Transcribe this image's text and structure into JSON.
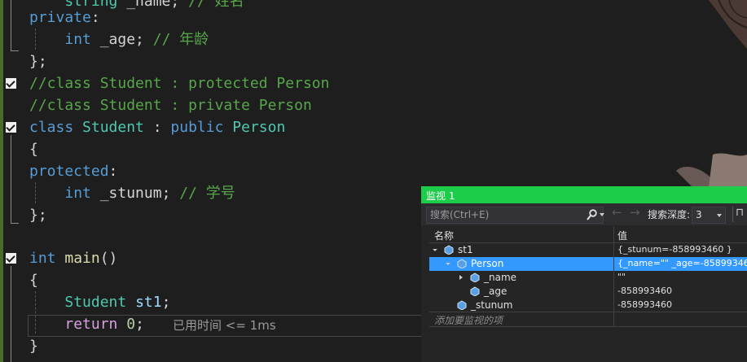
{
  "editor": {
    "lines": [
      {
        "id": "l0",
        "segments": [
          {
            "cls": "ty",
            "text": "    string"
          },
          {
            "cls": "",
            "text": " _name; "
          },
          {
            "cls": "cm",
            "text": "// 姓名"
          }
        ]
      },
      {
        "id": "l1",
        "segments": [
          {
            "cls": "kw",
            "text": "private"
          },
          {
            "cls": "",
            "text": ":"
          }
        ]
      },
      {
        "id": "l2",
        "segments": [
          {
            "cls": "",
            "text": "    "
          },
          {
            "cls": "kw",
            "text": "int"
          },
          {
            "cls": "",
            "text": " _age; "
          },
          {
            "cls": "cm",
            "text": "// 年龄"
          }
        ]
      },
      {
        "id": "l3",
        "segments": [
          {
            "cls": "",
            "text": "};"
          }
        ]
      },
      {
        "id": "l4",
        "segments": [
          {
            "cls": "cm",
            "text": "//class Student : protected Person"
          }
        ]
      },
      {
        "id": "l5",
        "segments": [
          {
            "cls": "cm",
            "text": "//class Student : private Person"
          }
        ]
      },
      {
        "id": "l6",
        "segments": [
          {
            "cls": "kw",
            "text": "class"
          },
          {
            "cls": "",
            "text": " "
          },
          {
            "cls": "ty",
            "text": "Student"
          },
          {
            "cls": "",
            "text": " : "
          },
          {
            "cls": "kw",
            "text": "public"
          },
          {
            "cls": "",
            "text": " "
          },
          {
            "cls": "ty",
            "text": "Person"
          }
        ]
      },
      {
        "id": "l7",
        "segments": [
          {
            "cls": "",
            "text": "{"
          }
        ]
      },
      {
        "id": "l8",
        "segments": [
          {
            "cls": "kw",
            "text": "protected"
          },
          {
            "cls": "",
            "text": ":"
          }
        ]
      },
      {
        "id": "l9",
        "segments": [
          {
            "cls": "",
            "text": "    "
          },
          {
            "cls": "kw",
            "text": "int"
          },
          {
            "cls": "",
            "text": " _stunum; "
          },
          {
            "cls": "cm",
            "text": "// 学号"
          }
        ]
      },
      {
        "id": "l10",
        "segments": [
          {
            "cls": "",
            "text": "};"
          }
        ]
      },
      {
        "id": "l11",
        "segments": [
          {
            "cls": "kw",
            "text": "int"
          },
          {
            "cls": "",
            "text": " "
          },
          {
            "cls": "fn",
            "text": "main"
          },
          {
            "cls": "",
            "text": "()"
          }
        ]
      },
      {
        "id": "l12",
        "segments": [
          {
            "cls": "",
            "text": "{"
          }
        ]
      },
      {
        "id": "l13",
        "segments": [
          {
            "cls": "",
            "text": "    "
          },
          {
            "cls": "ty",
            "text": "Student"
          },
          {
            "cls": "",
            "text": " "
          },
          {
            "cls": "vr",
            "text": "st1"
          },
          {
            "cls": "",
            "text": ";"
          }
        ]
      },
      {
        "id": "l14",
        "segments": [
          {
            "cls": "",
            "text": "    "
          },
          {
            "cls": "ctl",
            "text": "return"
          },
          {
            "cls": "",
            "text": " "
          },
          {
            "cls": "nm",
            "text": "0"
          },
          {
            "cls": "",
            "text": ";"
          }
        ]
      },
      {
        "id": "l15",
        "segments": [
          {
            "cls": "",
            "text": "}"
          }
        ]
      }
    ],
    "perf_tip": "已用时间 <= 1ms"
  },
  "watch": {
    "title": "监视 1",
    "search_placeholder": "搜索(Ctrl+E)",
    "depth_label": "搜索深度:",
    "depth_value": "3",
    "col_name": "名称",
    "col_value": "值",
    "rows": [
      {
        "name": "st1",
        "value": "{_stunum=-858993460 }",
        "expander": "open",
        "selected": false
      },
      {
        "name": "Person",
        "value": "{_name=\"\" _age=-858993460 }",
        "expander": "open",
        "selected": true
      },
      {
        "name": "_name",
        "value": "\"\"",
        "expander": "closed",
        "selected": false
      },
      {
        "name": "_age",
        "value": "-858993460",
        "expander": "none",
        "selected": false
      },
      {
        "name": "_stunum",
        "value": "-858993460",
        "expander": "none",
        "selected": false
      }
    ],
    "add_placeholder": "添加要监视的项"
  },
  "icons": [
    "search-icon",
    "back-arrow-icon",
    "forward-arrow-icon",
    "pin-icon",
    "object-icon",
    "lock-icon"
  ]
}
